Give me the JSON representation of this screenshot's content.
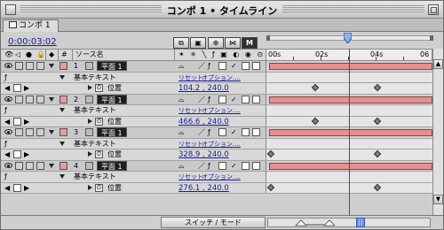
{
  "window": {
    "title": "コンポ 1 • タイムライン"
  },
  "tab": {
    "label": "コンポ 1"
  },
  "timecode": "0:00:03:02",
  "toolbar": {
    "btn_m_label": "M"
  },
  "columns": {
    "source_name": "ソース名"
  },
  "ruler": {
    "labels": [
      "00s",
      "02s",
      "04s",
      "06"
    ]
  },
  "layers": [
    {
      "num": "1",
      "name": "平面 1",
      "prop": "基本テキスト",
      "sub": "位置",
      "reset": "リセット",
      "options": "オプション....",
      "value": "104.2 , 240.0",
      "keys_label": "keyframes"
    },
    {
      "num": "2",
      "name": "平面 1",
      "prop": "基本テキスト",
      "sub": "位置",
      "reset": "リセット",
      "options": "オプション....",
      "value": "466.6 , 240.0",
      "keys_label": "keyframes"
    },
    {
      "num": "3",
      "name": "平面 1",
      "prop": "基本テキスト",
      "sub": "位置",
      "reset": "リセット",
      "options": "オプション....",
      "value": "328.9 , 240.0",
      "keys_label": "keyframes"
    },
    {
      "num": "4",
      "name": "平面 1",
      "prop": "基本テキスト",
      "sub": "位置",
      "reset": "リセット",
      "options": "オプション....",
      "value": "276.1 , 240.0",
      "keys_label": "keyframes"
    }
  ],
  "bottom": {
    "switch_mode": "スイッチ / モード"
  },
  "colors": {
    "bar": "#e98f8f",
    "cti": "#d11a1a",
    "link": "#1818a8"
  }
}
